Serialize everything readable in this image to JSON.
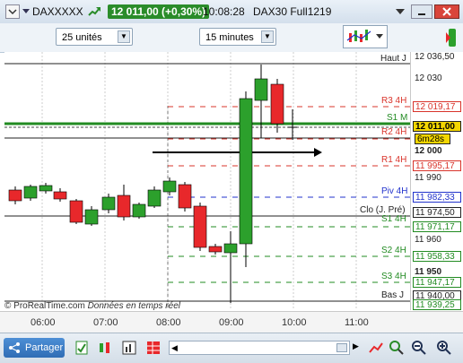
{
  "titlebar": {
    "symbol": "DAXXXXX",
    "price_badge": "12 011,00 (+0,30%)",
    "time": "10:08:28",
    "instrument": "DAX30 Full1219"
  },
  "toolbar": {
    "units_select": "25 unités",
    "timeframe_select": "15 minutes"
  },
  "chart": {
    "copyright": "© ProRealTime.com",
    "copyright_note": "Données en temps réel",
    "levels": {
      "haut": "Haut J",
      "r3": "R3 4H",
      "s1m": "S1 M",
      "r2": "R2 4H",
      "r1": "R1 4H",
      "piv": "Piv 4H",
      "clo": "Clo (J. Pré)",
      "s1": "S1 4H",
      "s2": "S2 4H",
      "s3": "S3 4H",
      "bas": "Bas J"
    },
    "colors": {
      "up": "#2ca02c",
      "down": "#e8282b",
      "pivot_green": "#228b22",
      "pivot_red": "#d9342b",
      "pivot_blue": "#2233cc"
    }
  },
  "price_axis": {
    "labels": {
      "p12036": "12 036,50",
      "p12030": "12 030",
      "p12019": "12 019,17",
      "p12011": "12 011,00",
      "countdown": "6m28s",
      "p12000": "12 000",
      "p11995": "11 995,17",
      "p11990": "11 990",
      "p11982": "11 982,33",
      "p11974": "11 974,50",
      "p11971": "11 971,17",
      "p11960": "11 960",
      "p11958": "11 958,33",
      "p11950": "11 950",
      "p11947": "11 947,17",
      "p11940": "11 940,00",
      "p11939": "11 939,25"
    }
  },
  "time_axis": {
    "t0600": "06:00",
    "t0700": "07:00",
    "t0800": "08:00",
    "t0900": "09:00",
    "t1000": "10:00",
    "t1100": "11:00"
  },
  "bottombar": {
    "share_label": "Partager"
  }
}
